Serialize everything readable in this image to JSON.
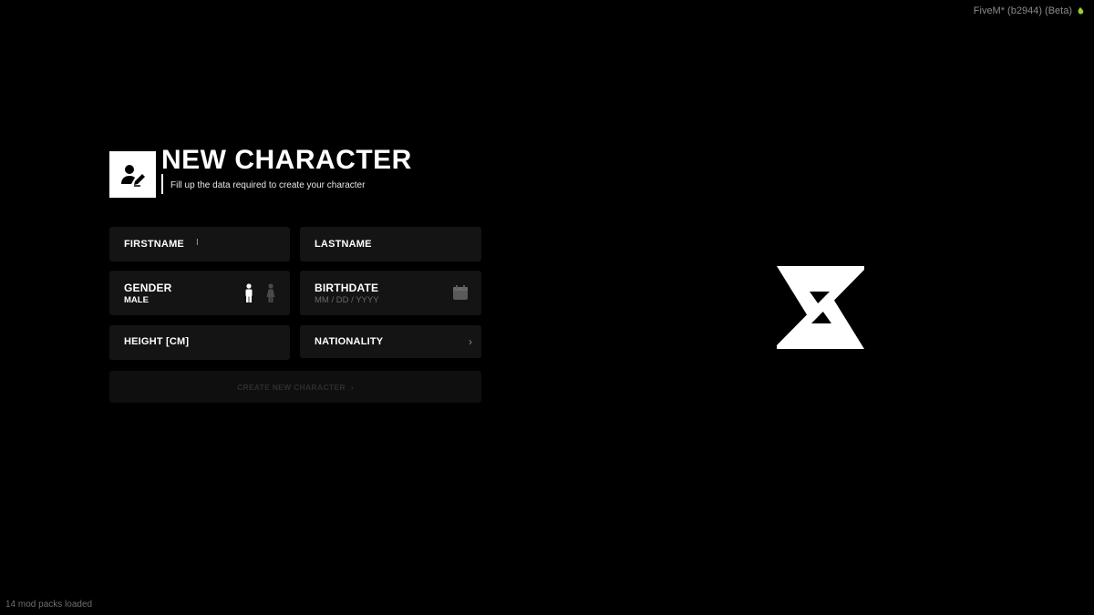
{
  "client": {
    "label": "FiveM* (b2944) (Beta)",
    "icon": "pear-icon"
  },
  "status": {
    "text": "14 mod packs loaded"
  },
  "header": {
    "icon": "user-edit-icon",
    "title": "NEW CHARACTER",
    "subtitle": "Fill up the data required to create your character"
  },
  "form": {
    "firstname": {
      "label": "FIRSTNAME",
      "value": ""
    },
    "lastname": {
      "label": "LASTNAME",
      "value": ""
    },
    "gender": {
      "label": "GENDER",
      "value": "MALE",
      "options": [
        "male-icon",
        "female-icon"
      ]
    },
    "birthdate": {
      "label": "BIRTHDATE",
      "placeholder": "MM / DD / YYYY",
      "icon": "calendar-icon"
    },
    "height": {
      "label": "HEIGHT [CM]",
      "value": ""
    },
    "nationality": {
      "label": "NATIONALITY",
      "icon": "chevron-right-icon"
    },
    "submit": {
      "label": "CREATE NEW CHARACTER",
      "icon": "chevron-right-icon"
    }
  },
  "logo": {
    "name": "z-logo-icon"
  },
  "colors": {
    "background": "#000000",
    "field_bg": "#141414",
    "accent": "#ffffff",
    "muted_text": "#6a6a6a",
    "client_icon": "#9acd32"
  }
}
